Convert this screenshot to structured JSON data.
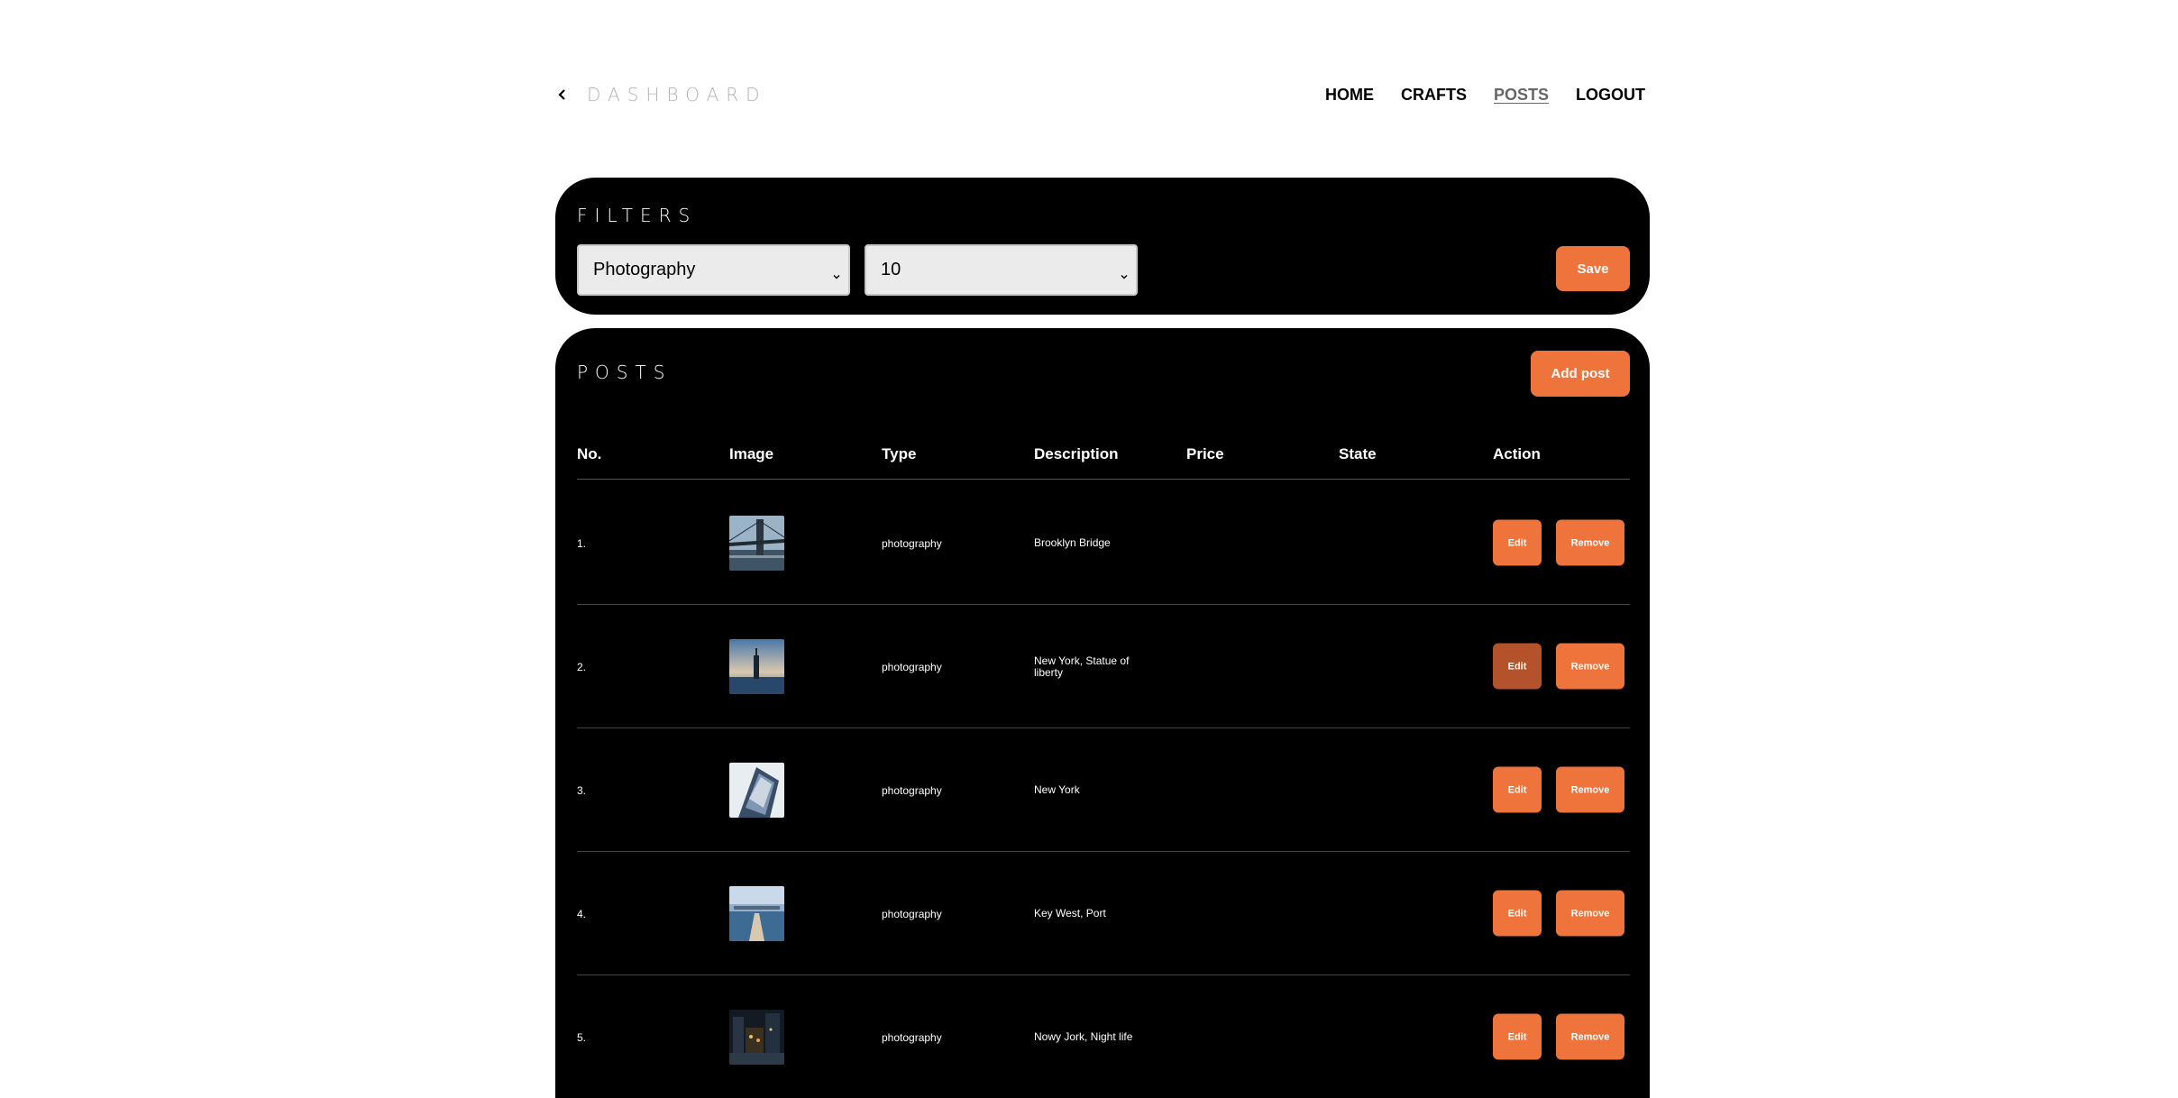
{
  "header": {
    "back_label": "DASHBOARD",
    "nav": [
      {
        "label": "HOME"
      },
      {
        "label": "CRAFTS"
      },
      {
        "label": "POSTS",
        "active": true
      },
      {
        "label": "LOGOUT"
      }
    ]
  },
  "filters": {
    "title": "FILTERS",
    "category_value": "Photography",
    "limit_value": "10",
    "save_label": "Save"
  },
  "posts": {
    "title": "POSTS",
    "add_label": "Add post",
    "columns": [
      "No.",
      "Image",
      "Type",
      "Description",
      "Price",
      "State",
      "Action"
    ],
    "rows": [
      {
        "no": "1.",
        "type": "photography",
        "description": "Brooklyn Bridge",
        "price": "",
        "state": "",
        "image": "bridge-photo",
        "edit_label": "Edit",
        "remove_label": "Remove"
      },
      {
        "no": "2.",
        "type": "photography",
        "description": "New York,  Statue of liberty",
        "price": "",
        "state": "",
        "image": "statue-photo",
        "edit_label": "Edit",
        "remove_label": "Remove",
        "edit_pressed": true
      },
      {
        "no": "3.",
        "type": "photography",
        "description": "New York",
        "price": "",
        "state": "",
        "image": "building-photo",
        "edit_label": "Edit",
        "remove_label": "Remove"
      },
      {
        "no": "4.",
        "type": "photography",
        "description": "Key West, Port",
        "price": "",
        "state": "",
        "image": "port-photo",
        "edit_label": "Edit",
        "remove_label": "Remove"
      },
      {
        "no": "5.",
        "type": "photography",
        "description": "Nowy Jork, Night life",
        "price": "",
        "state": "",
        "image": "night-photo",
        "edit_label": "Edit",
        "remove_label": "Remove"
      }
    ]
  },
  "colors": {
    "accent": "#ef743b",
    "accent_pressed": "#b4532b",
    "panel": "#000000"
  }
}
